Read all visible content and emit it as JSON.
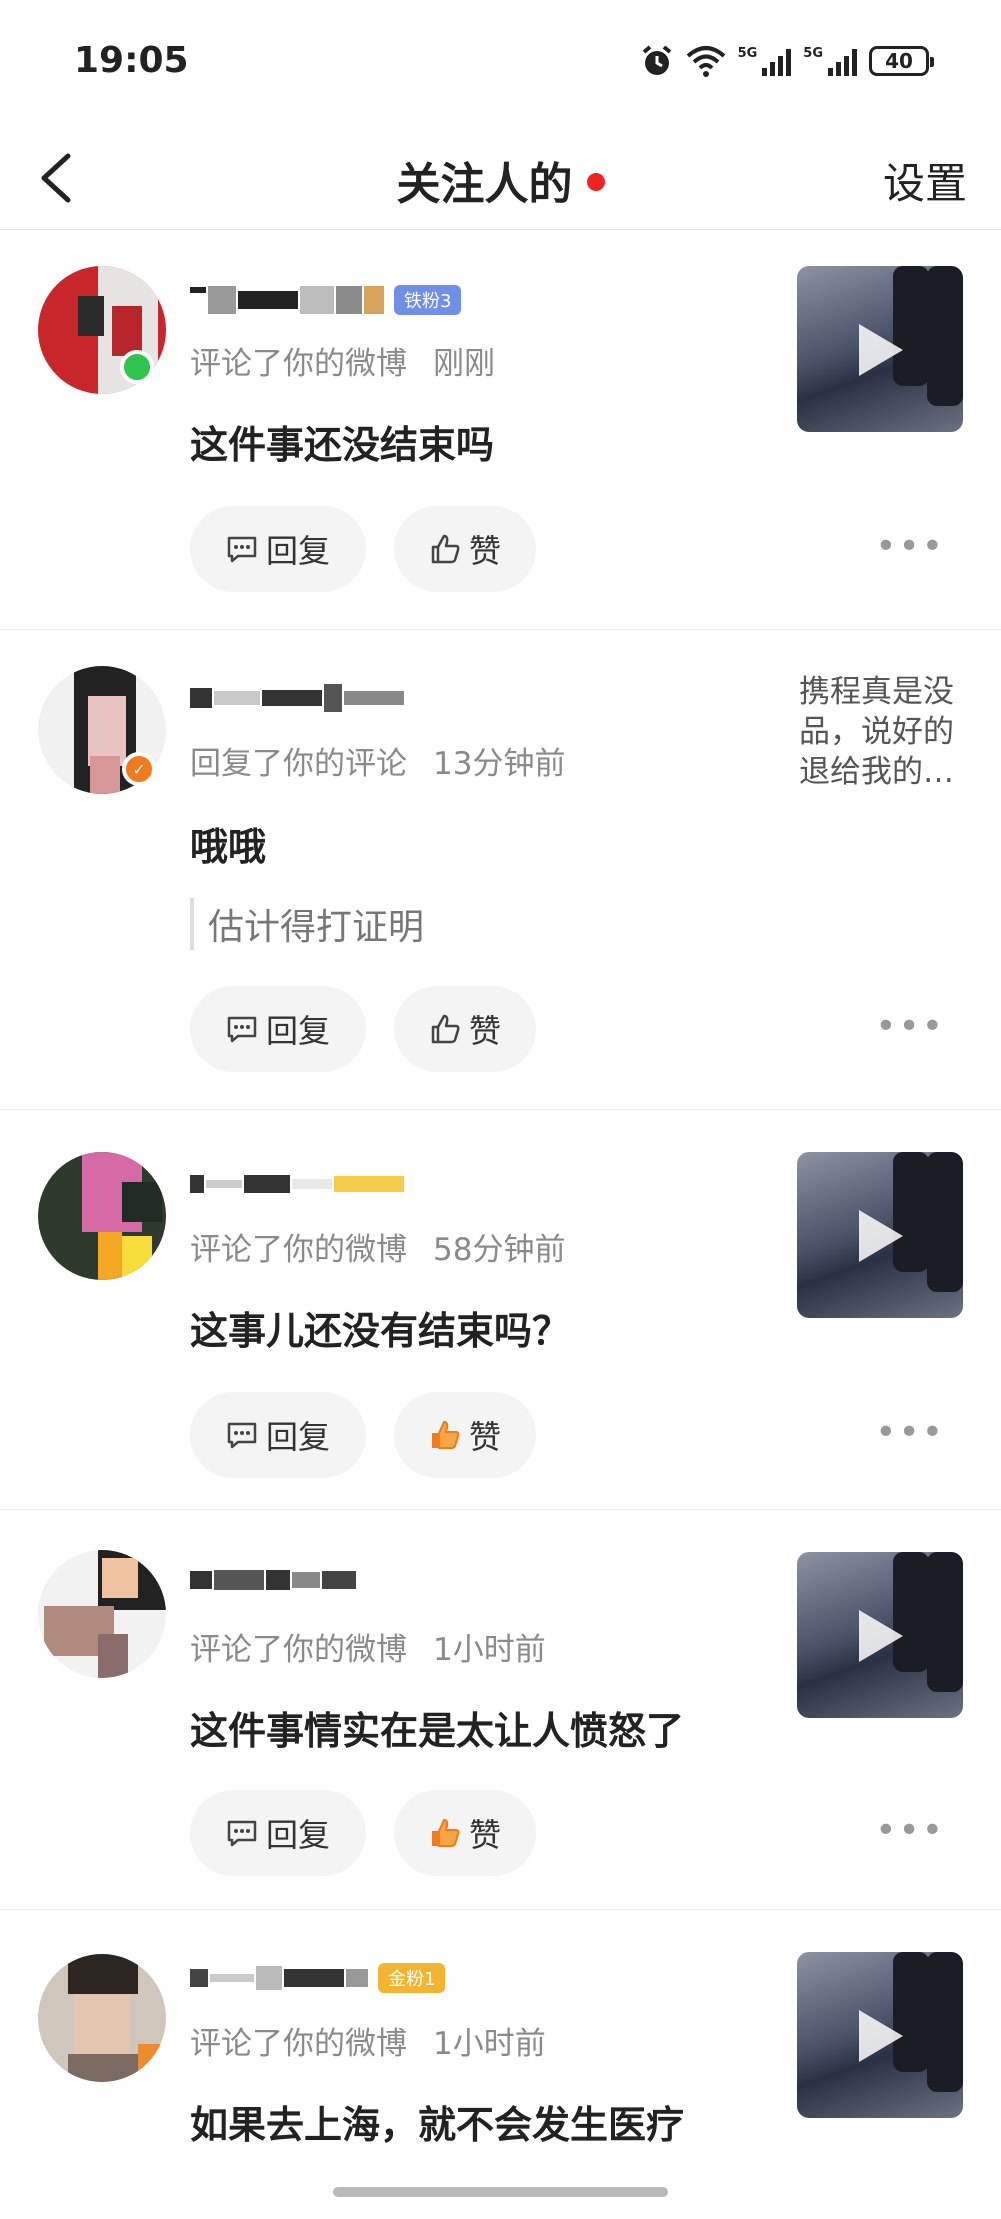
{
  "status_bar": {
    "time": "19:05",
    "battery": "40",
    "network_tags": [
      "5G",
      "5G"
    ],
    "icons": [
      "alarm-icon",
      "wifi-icon",
      "signal-icon",
      "signal-icon",
      "battery-icon"
    ]
  },
  "nav": {
    "title": "关注人的",
    "settings_label": "设置",
    "unread_dot_color": "#f0231f"
  },
  "items": [
    {
      "fan_badge": "铁粉3",
      "action": "评论了你的微博",
      "time": "刚刚",
      "content": "这件事还没结束吗",
      "reply_label": "回复",
      "like_label": "赞",
      "liked": false,
      "attachment": "video"
    },
    {
      "action": "回复了你的评论",
      "time": "13分钟前",
      "content": "哦哦",
      "quote": "估计得打证明",
      "reply_label": "回复",
      "like_label": "赞",
      "liked": false,
      "attachment_text": "携程真是没品，说好的退给我的…"
    },
    {
      "action": "评论了你的微博",
      "time": "58分钟前",
      "content": "这事儿还没有结束吗？",
      "reply_label": "回复",
      "like_label": "赞",
      "liked": true,
      "attachment": "video"
    },
    {
      "action": "评论了你的微博",
      "time": "1小时前",
      "content": "这件事情实在是太让人愤怒了",
      "reply_label": "回复",
      "like_label": "赞",
      "liked": true,
      "attachment": "video"
    },
    {
      "fan_badge": "金粉1",
      "action": "评论了你的微博",
      "time": "1小时前",
      "content": "如果去上海，就不会发生医疗",
      "attachment": "video"
    }
  ],
  "colors": {
    "liked": "#f07a1e",
    "fan_iron": "#6f8fe8",
    "fan_gold": "#f2b431",
    "online": "#2fc44b"
  }
}
